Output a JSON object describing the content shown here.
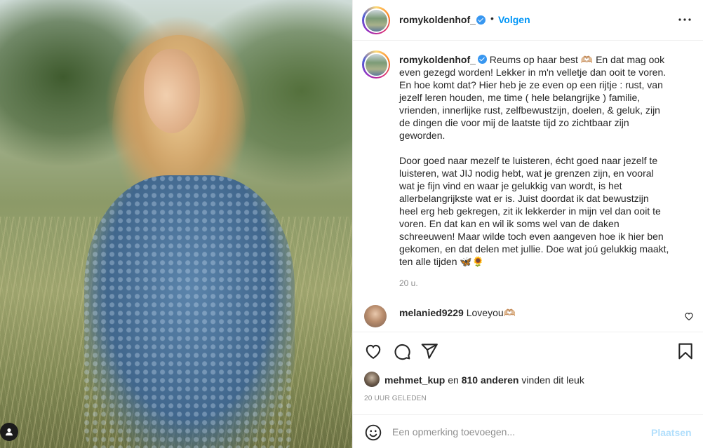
{
  "post": {
    "author": {
      "username": "romykoldenhof_",
      "verified": true
    },
    "header": {
      "separator": "•",
      "follow_label": "Volgen"
    },
    "caption": {
      "username": "romykoldenhof_",
      "text": "Reums op haar best 🫶🏼 En dat mag ook\neven gezegd worden! Lekker in m'n velletje dan ooit te voren.\nEn hoe komt dat? Hier heb je ze even op een rijtje : rust, van\njezelf leren houden, me time ( hele belangrijke ) familie,\nvrienden, innerlijke rust, zelfbewustzijn, doelen, & geluk, zijn\nde dingen die voor mij de laatste tijd zo zichtbaar zijn\ngeworden.\n\nDoor goed naar mezelf te luisteren, écht goed naar jezelf te\nluisteren, wat JIJ nodig hebt, wat je grenzen zijn, en vooral\nwat je fijn vind en waar je gelukkig van wordt, is het\nallerbelangrijkste wat er is. Juist doordat ik dat bewustzijn\nheel erg heb gekregen, zit ik lekkerder in mijn vel dan ooit te\nvoren. En dat kan en wil ik soms wel van de daken\nschreeuwen! Maar wilde toch even aangeven hoe ik hier ben\ngekomen, en dat delen met jullie. Doe wat joú gelukkig maakt,\nten alle tijden 🦋🌻",
      "time_ago": "20 u."
    },
    "comments": [
      {
        "username": "melanied9229",
        "text": "Loveyou🫶🏼"
      }
    ],
    "likes": {
      "user": "mehmet_kup",
      "connector": "en",
      "count_label": "810 anderen",
      "suffix": "vinden dit leuk"
    },
    "posted": "20 UUR GELEDEN",
    "add_comment": {
      "placeholder": "Een opmerking toevoegen...",
      "post_label": "Plaatsen"
    }
  },
  "icons": {
    "more": "more-options-icon",
    "like": "heart-icon",
    "comment": "comment-icon",
    "share": "paper-plane-icon",
    "save": "bookmark-icon",
    "emoji": "emoji-icon",
    "photo_user": "user-tag-icon"
  },
  "colors": {
    "accent": "#0095f6",
    "post_disabled": "#b2dffc",
    "verified": "#3897f0",
    "muted": "#8e8e8e"
  }
}
